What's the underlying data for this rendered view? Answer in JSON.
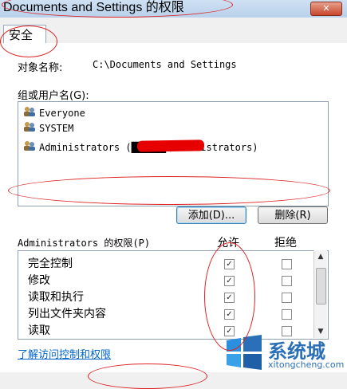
{
  "window": {
    "title": "Documents and Settings 的权限",
    "close": "✕"
  },
  "tabs": [
    {
      "label": "安全"
    }
  ],
  "object": {
    "label": "对象名称:",
    "value": "C:\\Documents and Settings"
  },
  "users": {
    "label": "组或用户名(G):",
    "items": [
      {
        "name": "Everyone"
      },
      {
        "name": "SYSTEM"
      },
      {
        "name": "Administrators (██████\\Administrators)"
      }
    ]
  },
  "buttons": {
    "add": "添加(D)...",
    "remove": "删除(R)"
  },
  "permissions": {
    "for_label": "Administrators 的权限(P)",
    "allow_header": "允许",
    "deny_header": "拒绝",
    "rows": [
      {
        "name": "完全控制",
        "allow": true,
        "deny": false
      },
      {
        "name": "修改",
        "allow": true,
        "deny": false
      },
      {
        "name": "读取和执行",
        "allow": true,
        "deny": false
      },
      {
        "name": "列出文件夹内容",
        "allow": true,
        "deny": false
      },
      {
        "name": "读取",
        "allow": true,
        "deny": false
      }
    ]
  },
  "link": "了解访问控制和权限",
  "watermark": {
    "name": "系统城",
    "url": "xitongcheng.com"
  },
  "colors": {
    "annotation": "#dd2222",
    "link": "#0066cc",
    "brand": "#2a6fb8"
  }
}
